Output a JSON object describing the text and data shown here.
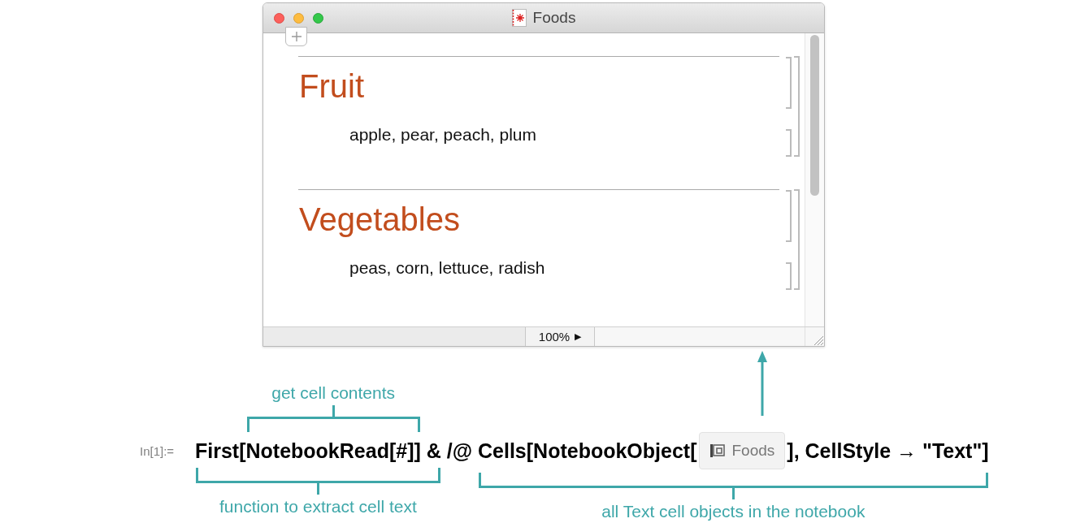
{
  "window": {
    "title": "Foods",
    "cells": [
      {
        "kind": "title",
        "text": "Fruit",
        "group_start": true
      },
      {
        "kind": "text",
        "text": "apple, pear, peach, plum",
        "group_start": false
      },
      {
        "kind": "title",
        "text": "Vegetables",
        "group_start": true
      },
      {
        "kind": "text",
        "text": "peas, corn, lettuce, radish",
        "group_start": false
      }
    ],
    "zoom": "100%",
    "zoom_arrow": "▶"
  },
  "input": {
    "label": "In[1]:=",
    "parts": [
      {
        "kind": "group_below",
        "note": "function to extract cell text",
        "parts": [
          {
            "kind": "code",
            "text": "First["
          },
          {
            "kind": "group_above",
            "note": "get cell contents",
            "parts": [
              {
                "kind": "code",
                "text": "NotebookRead[#]]"
              }
            ]
          },
          {
            "kind": "code",
            "text": " &"
          }
        ]
      },
      {
        "kind": "code",
        "text": " /@ "
      },
      {
        "kind": "group_below",
        "note": "all Text cell objects in the notebook",
        "parts": [
          {
            "kind": "code",
            "text": "Cells[NotebookObject["
          },
          {
            "kind": "object",
            "text": "Foods"
          },
          {
            "kind": "code",
            "text": "], CellStyle → \"Text\"]"
          }
        ]
      }
    ]
  }
}
